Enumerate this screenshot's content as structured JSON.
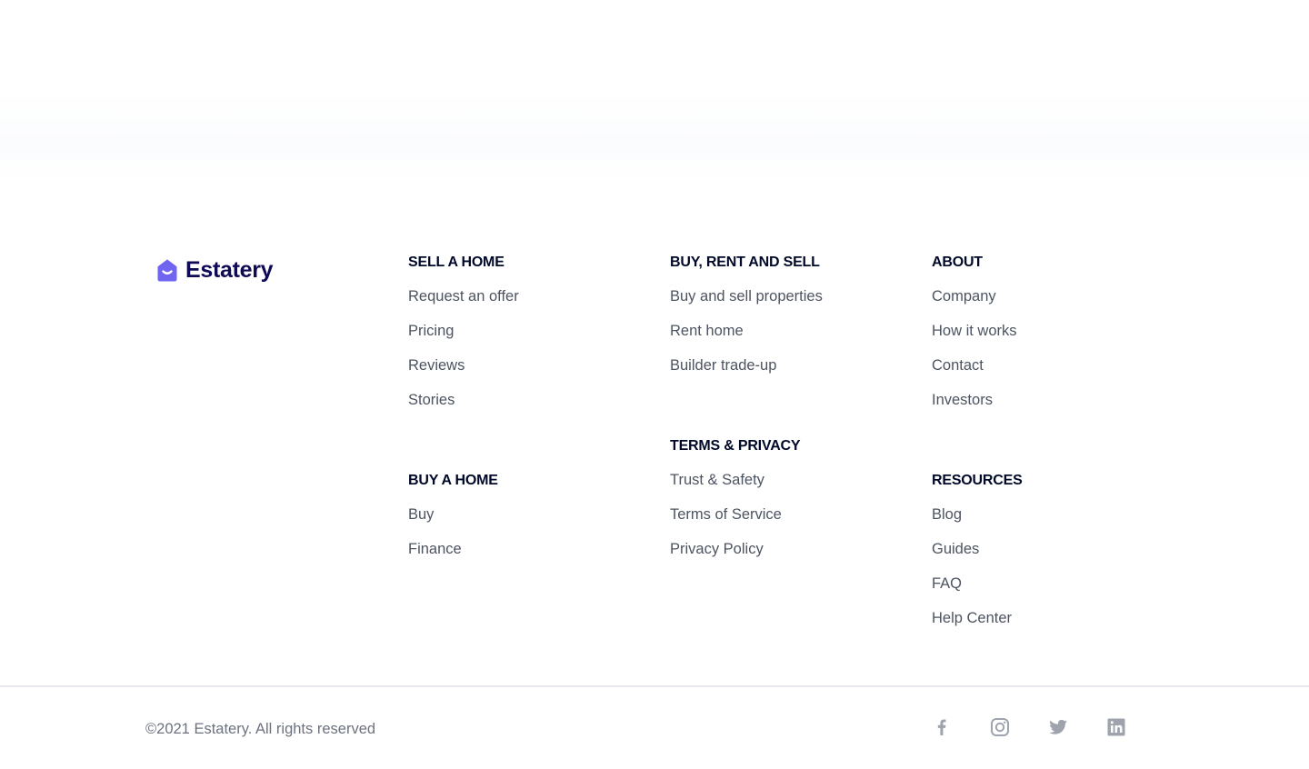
{
  "brand": {
    "name": "Estatery",
    "icon": "house-smile-icon",
    "accent_color": "#7065f0",
    "text_color": "#100a55"
  },
  "footer": {
    "sell_a_home": {
      "heading": "SELL A HOME",
      "links": [
        "Request an offer",
        "Pricing",
        "Reviews",
        "Stories"
      ]
    },
    "buy_a_home": {
      "heading": "BUY A HOME",
      "links": [
        "Buy",
        "Finance"
      ]
    },
    "buy_rent_sell": {
      "heading": "BUY, RENT AND SELL",
      "links": [
        "Buy and sell properties",
        "Rent home",
        "Builder trade-up"
      ]
    },
    "terms_privacy": {
      "heading": "TERMS & PRIVACY",
      "links": [
        "Trust & Safety",
        "Terms of Service",
        "Privacy Policy"
      ]
    },
    "about": {
      "heading": "ABOUT",
      "links": [
        "Company",
        "How it works",
        "Contact",
        "Investors"
      ]
    },
    "resources": {
      "heading": "RESOURCES",
      "links": [
        "Blog",
        "Guides",
        "FAQ",
        "Help Center"
      ]
    }
  },
  "bottom_bar": {
    "copyright": "©2021 Estatery. All rights reserved",
    "social": [
      "facebook-icon",
      "instagram-icon",
      "twitter-icon",
      "linkedin-icon"
    ],
    "icon_color": "#9ea3ae"
  }
}
